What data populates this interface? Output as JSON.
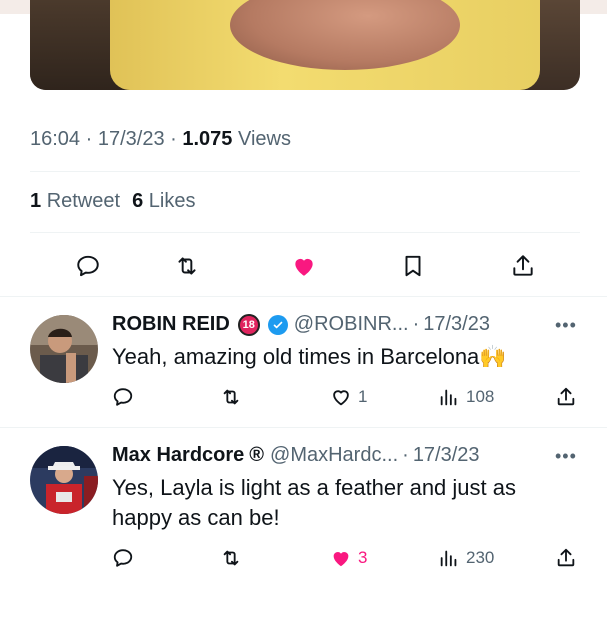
{
  "tweet": {
    "time": "16:04",
    "date": "17/3/23",
    "views_count": "1.075",
    "views_label": "Views",
    "retweets_count": "1",
    "retweets_label": "Retweet",
    "likes_count": "6",
    "likes_label": "Likes",
    "liked": true,
    "icons": [
      "reply-icon",
      "retweet-icon",
      "heart-icon",
      "bookmark-icon",
      "share-icon"
    ]
  },
  "replies": [
    {
      "name": "ROBIN REID",
      "badge": "18",
      "handle": "@ROBINR...",
      "date": "17/3/23",
      "text": "Yeah, amazing old times in Barcelona",
      "emoji": "🙌",
      "likes": "1",
      "views": "108",
      "liked": false
    },
    {
      "name": "Max Hardcore",
      "name_mark": "®",
      "handle": "@MaxHardc...",
      "date": "17/3/23",
      "text": "Yes, Layla is light as a feather and just as happy as can be!",
      "likes": "3",
      "views": "230",
      "liked": true
    }
  ],
  "colors": {
    "accent": "#f91880",
    "verified": "#1d9bf0",
    "muted": "#536471",
    "text": "#0f1419"
  }
}
